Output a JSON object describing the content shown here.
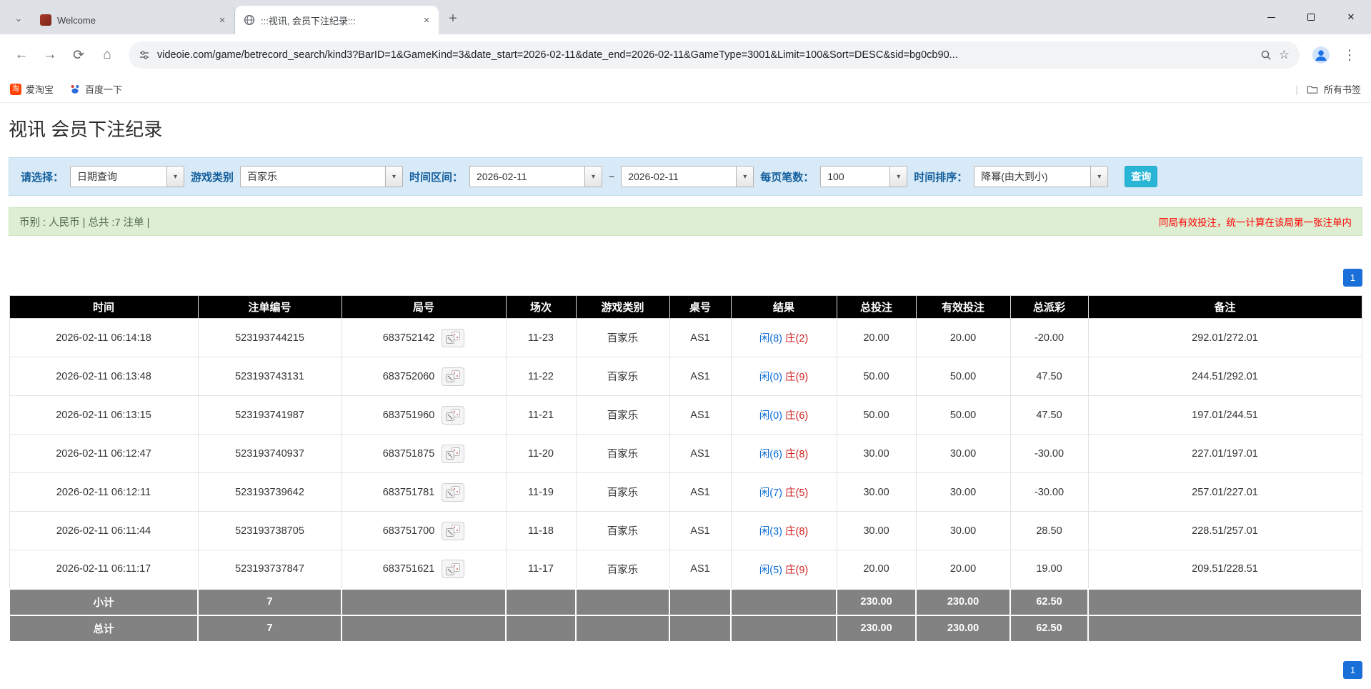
{
  "browser": {
    "tabs": [
      {
        "label": "Welcome"
      },
      {
        "label": ":::视讯, 会员下注纪录:::"
      }
    ],
    "url": "videoie.com/game/betrecord_search/kind3?BarID=1&GameKind=3&date_start=2026-02-11&date_end=2026-02-11&GameType=3001&Limit=100&Sort=DESC&sid=bg0cb90...",
    "bookmarks": [
      {
        "label": "爱淘宝"
      },
      {
        "label": "百度一下"
      }
    ],
    "all_bookmarks": "所有书签",
    "icons": {
      "tab_search": "⌄",
      "close_tab": "×",
      "new_tab": "+",
      "close_window": "✕",
      "back": "←",
      "forward": "→",
      "reload": "⟳",
      "home": "⌂",
      "star": "☆",
      "menu": "⋮",
      "bookmarks_divider": "|",
      "taobao_glyph": "淘",
      "caret": "▾"
    }
  },
  "page": {
    "title": "视讯 会员下注纪录",
    "filters": {
      "select_label": "请选择：",
      "select_value": "日期查询",
      "game_kind_label": "游戏类别",
      "game_kind_value": "百家乐",
      "date_range_label": "时间区间：",
      "date_start": "2026-02-11",
      "date_separator": "~",
      "date_end": "2026-02-11",
      "page_size_label": "每页笔数：",
      "page_size_value": "100",
      "sort_label": "时间排序：",
      "sort_value": "降幂(由大到小)",
      "search_button": "查询",
      "caret": "▾"
    },
    "summary": {
      "left": "币别 : 人民币 | 总共 :7 注单 |",
      "right": "同局有效投注，统一计算在该局第一张注单内"
    },
    "pagination": "1"
  },
  "table": {
    "headers": [
      "时间",
      "注单编号",
      "局号",
      "场次",
      "游戏类别",
      "桌号",
      "结果",
      "总投注",
      "有效投注",
      "总派彩",
      "备注"
    ],
    "rows": [
      {
        "time": "2026-02-11 06:14:18",
        "bet_id": "523193744215",
        "round_id": "683752142",
        "session": "11-23",
        "game": "百家乐",
        "table_no": "AS1",
        "result_player": "闲(8)",
        "result_banker": "庄(2)",
        "total_bet": "20.00",
        "valid_bet": "20.00",
        "payout": "-20.00",
        "remark": "292.01/272.01"
      },
      {
        "time": "2026-02-11 06:13:48",
        "bet_id": "523193743131",
        "round_id": "683752060",
        "session": "11-22",
        "game": "百家乐",
        "table_no": "AS1",
        "result_player": "闲(0)",
        "result_banker": "庄(9)",
        "total_bet": "50.00",
        "valid_bet": "50.00",
        "payout": "47.50",
        "remark": "244.51/292.01"
      },
      {
        "time": "2026-02-11 06:13:15",
        "bet_id": "523193741987",
        "round_id": "683751960",
        "session": "11-21",
        "game": "百家乐",
        "table_no": "AS1",
        "result_player": "闲(0)",
        "result_banker": "庄(6)",
        "total_bet": "50.00",
        "valid_bet": "50.00",
        "payout": "47.50",
        "remark": "197.01/244.51"
      },
      {
        "time": "2026-02-11 06:12:47",
        "bet_id": "523193740937",
        "round_id": "683751875",
        "session": "11-20",
        "game": "百家乐",
        "table_no": "AS1",
        "result_player": "闲(6)",
        "result_banker": "庄(8)",
        "total_bet": "30.00",
        "valid_bet": "30.00",
        "payout": "-30.00",
        "remark": "227.01/197.01"
      },
      {
        "time": "2026-02-11 06:12:11",
        "bet_id": "523193739642",
        "round_id": "683751781",
        "session": "11-19",
        "game": "百家乐",
        "table_no": "AS1",
        "result_player": "闲(7)",
        "result_banker": "庄(5)",
        "total_bet": "30.00",
        "valid_bet": "30.00",
        "payout": "-30.00",
        "remark": "257.01/227.01"
      },
      {
        "time": "2026-02-11 06:11:44",
        "bet_id": "523193738705",
        "round_id": "683751700",
        "session": "11-18",
        "game": "百家乐",
        "table_no": "AS1",
        "result_player": "闲(3)",
        "result_banker": "庄(8)",
        "total_bet": "30.00",
        "valid_bet": "30.00",
        "payout": "28.50",
        "remark": "228.51/257.01"
      },
      {
        "time": "2026-02-11 06:11:17",
        "bet_id": "523193737847",
        "round_id": "683751621",
        "session": "11-17",
        "game": "百家乐",
        "table_no": "AS1",
        "result_player": "闲(5)",
        "result_banker": "庄(9)",
        "total_bet": "20.00",
        "valid_bet": "20.00",
        "payout": "19.00",
        "remark": "209.51/228.51"
      }
    ],
    "subtotal": {
      "label": "小计",
      "count": "7",
      "total_bet": "230.00",
      "valid_bet": "230.00",
      "payout": "62.50"
    },
    "total": {
      "label": "总计",
      "count": "7",
      "total_bet": "230.00",
      "valid_bet": "230.00",
      "payout": "62.50"
    }
  },
  "colors": {
    "accent_blue": "#1b6fd8",
    "link_blue": "#0b6bd4",
    "negative_red": "#e02020",
    "banker_red": "#d02020",
    "player_blue": "#0b6bd4",
    "search_button_bg": "#29b6d6",
    "filter_label_blue": "#15609e",
    "filter_bar_bg": "#d8eaf7",
    "summary_bar_bg": "#ddeed2",
    "warning_red": "#ff0000",
    "table_header_bg": "#000000",
    "table_footer_bg": "#828282"
  }
}
